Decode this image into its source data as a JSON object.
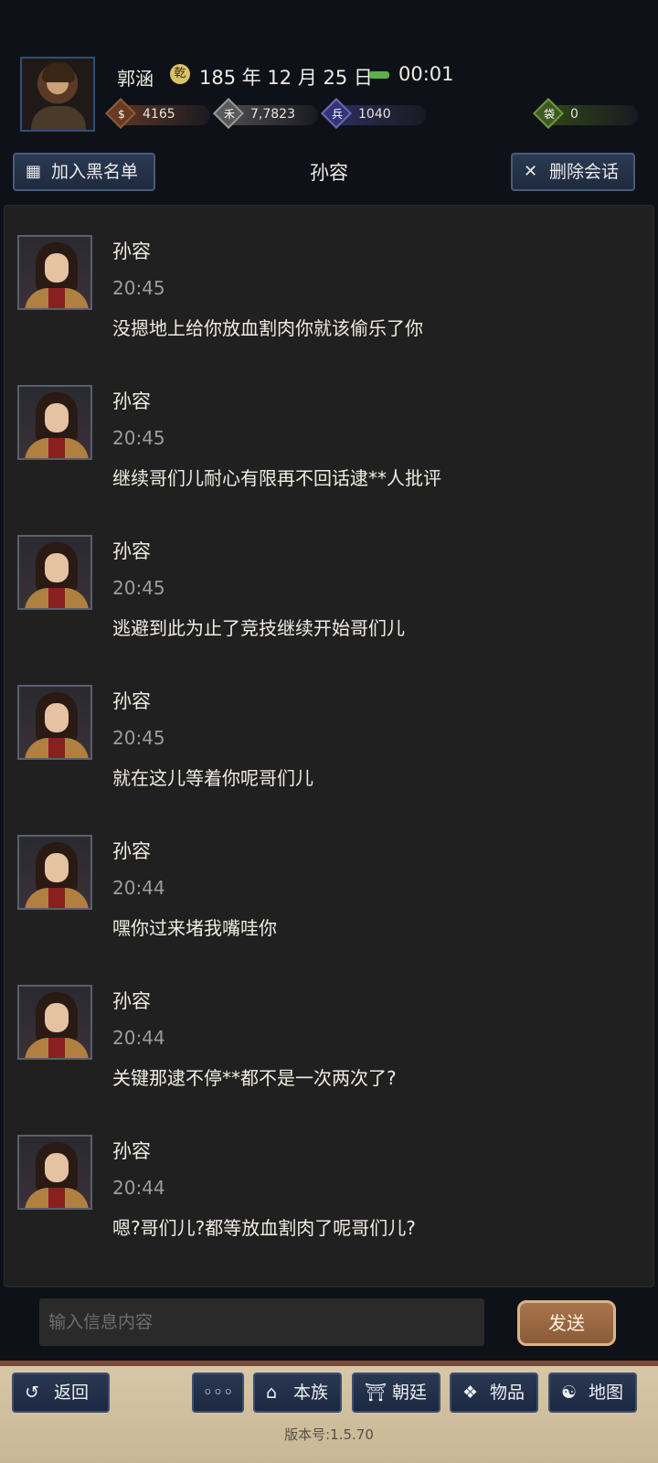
{
  "header": {
    "player_name": "郭涵",
    "date_icon_glyph": "乾",
    "date": "185 年 12 月 25 日",
    "time": "00:01",
    "resources": [
      {
        "icon": "coin-icon",
        "glyph": "$",
        "value": "4165",
        "color": "#7a4a2a"
      },
      {
        "icon": "grain-icon",
        "glyph": "禾",
        "value": "7,7823",
        "color": "#6a6a6a"
      },
      {
        "icon": "soldier-icon",
        "glyph": "兵",
        "value": "1040",
        "color": "#3a3a78"
      },
      {
        "icon": "bag-icon",
        "glyph": "袋",
        "value": "0",
        "color": "#3e5a24"
      }
    ]
  },
  "chat_header": {
    "blacklist_label": "加入黑名单",
    "title": "孙容",
    "delete_label": "删除会话"
  },
  "messages": [
    {
      "name": "孙容",
      "time": "20:45",
      "text": "没摁地上给你放血割肉你就该偷乐了你"
    },
    {
      "name": "孙容",
      "time": "20:45",
      "text": "继续哥们儿耐心有限再不回话逮**人批评"
    },
    {
      "name": "孙容",
      "time": "20:45",
      "text": "逃避到此为止了竞技继续开始哥们儿"
    },
    {
      "name": "孙容",
      "time": "20:45",
      "text": "就在这儿等着你呢哥们儿"
    },
    {
      "name": "孙容",
      "time": "20:44",
      "text": "嘿你过来堵我嘴哇你"
    },
    {
      "name": "孙容",
      "time": "20:44",
      "text": "关键那逮不停**都不是一次两次了?"
    },
    {
      "name": "孙容",
      "time": "20:44",
      "text": "嗯?哥们儿?都等放血割肉了呢哥们儿?"
    }
  ],
  "input": {
    "placeholder": "输入信息内容",
    "send_label": "发送"
  },
  "nav": {
    "back": "返回",
    "more": "◦◦◦",
    "clan": "本族",
    "court": "朝廷",
    "items": "物品",
    "map": "地图"
  },
  "version": "版本号:1.5.70"
}
